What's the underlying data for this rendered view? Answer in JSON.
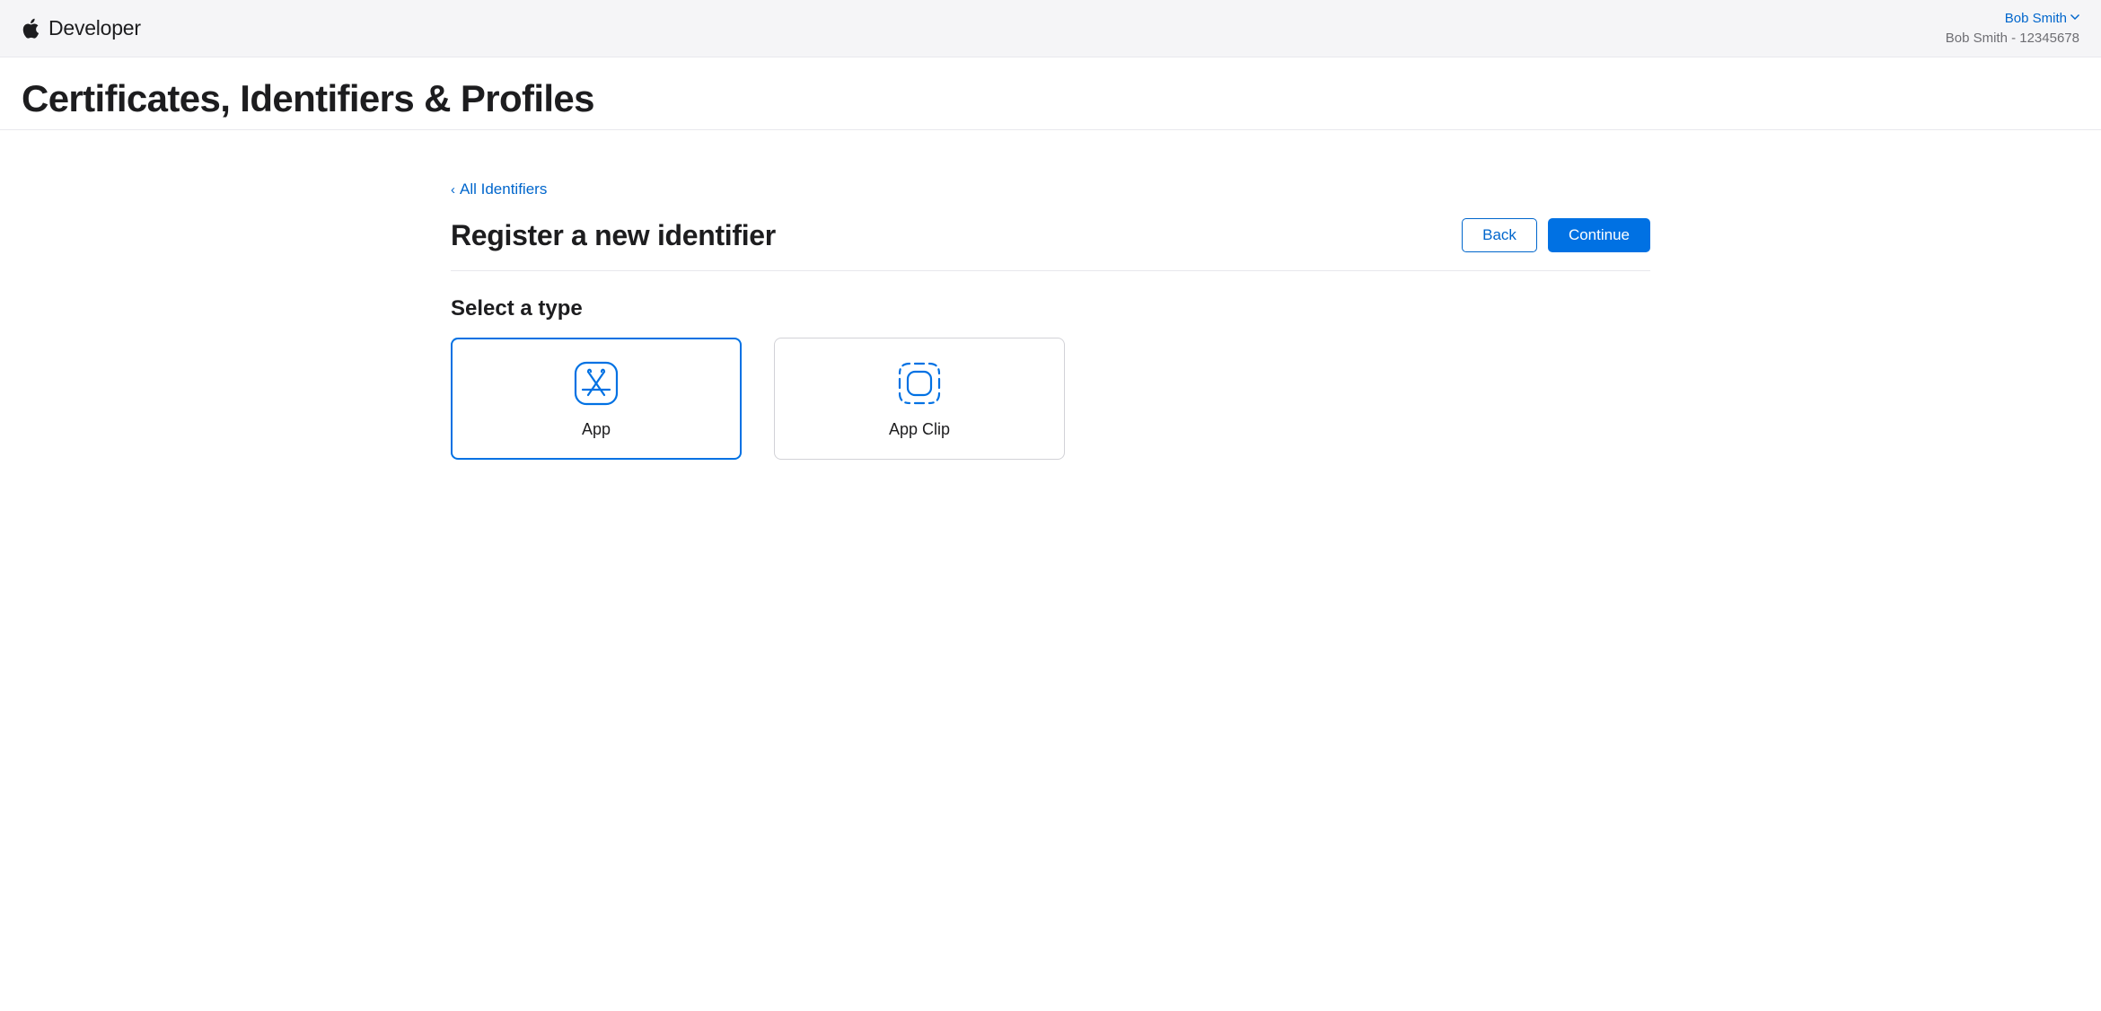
{
  "header": {
    "product": "Developer",
    "account_name": "Bob Smith",
    "team_line": "Bob Smith - 12345678"
  },
  "page": {
    "title": "Certificates, Identifiers & Profiles"
  },
  "breadcrumb": {
    "back_label": "All Identifiers"
  },
  "section": {
    "title": "Register a new identifier",
    "back_button": "Back",
    "continue_button": "Continue"
  },
  "type_selection": {
    "heading": "Select a type",
    "options": [
      {
        "label": "App",
        "selected": true
      },
      {
        "label": "App Clip",
        "selected": false
      }
    ]
  }
}
